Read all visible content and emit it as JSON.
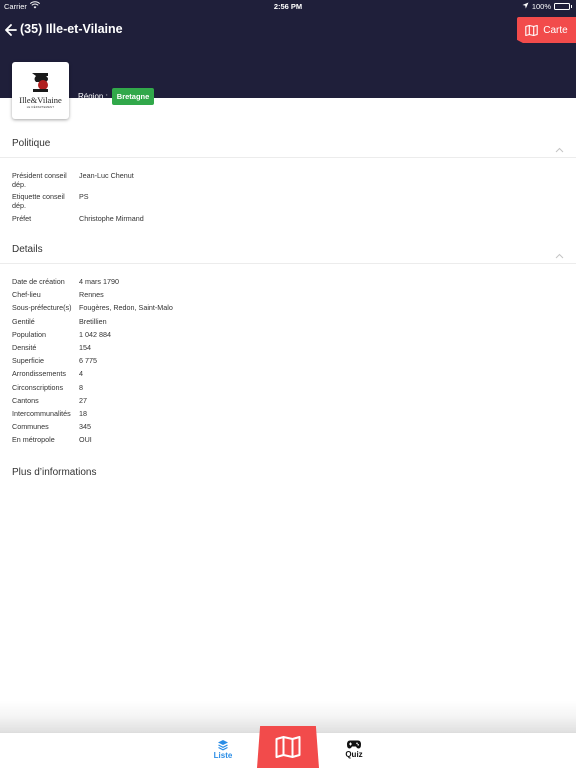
{
  "status_bar": {
    "carrier": "Carrier",
    "time": "2:56 PM",
    "battery": "100%"
  },
  "header": {
    "title": "(35) Ille-et-Vilaine",
    "carte_label": "Carte",
    "region_label": "Région :",
    "region_value": "Bretagne",
    "logo_text": "Ille&Vilaine",
    "logo_subtext": "LE DÉPARTEMENT"
  },
  "politique": {
    "title": "Politique",
    "rows": [
      {
        "label": "Président conseil dép.",
        "value": "Jean-Luc Chenut"
      },
      {
        "label": "Etiquette conseil dép.",
        "value": "PS"
      },
      {
        "label": "Préfet",
        "value": "Christophe Mirmand"
      }
    ]
  },
  "details": {
    "title": "Details",
    "rows": [
      {
        "label": "Date de création",
        "value": " 4 mars 1790"
      },
      {
        "label": "Chef-lieu",
        "value": "Rennes"
      },
      {
        "label": "Sous-préfecture(s)",
        "value": "Fougères, Redon, Saint-Malo"
      },
      {
        "label": "Gentilé",
        "value": "Bretillien"
      },
      {
        "label": "Population",
        "value": "1 042 884"
      },
      {
        "label": "Densité",
        "value": "154"
      },
      {
        "label": "Superficie",
        "value": "6 775"
      },
      {
        "label": "Arrondissements",
        "value": "4"
      },
      {
        "label": "Circonscriptions",
        "value": "8"
      },
      {
        "label": "Cantons",
        "value": "27"
      },
      {
        "label": "Intercommunalités",
        "value": "18"
      },
      {
        "label": "Communes",
        "value": "345"
      },
      {
        "label": "En métropole",
        "value": "OUI"
      }
    ]
  },
  "more": {
    "title": "Plus d’informations"
  },
  "tabs": {
    "liste": "Liste",
    "quiz": "Quiz"
  },
  "colors": {
    "header_bg": "#1f1f3a",
    "accent_red": "#f24b4b",
    "region_green": "#31a84a",
    "tab_active": "#2a8de6"
  }
}
